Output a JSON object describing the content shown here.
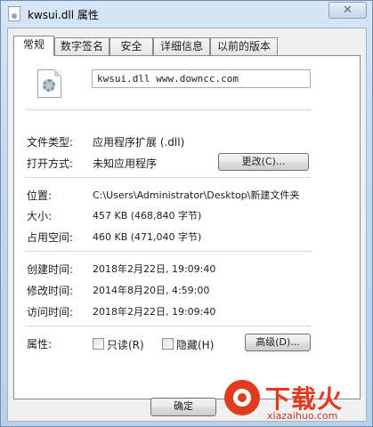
{
  "window": {
    "title": "kwsui.dll 属性",
    "close_glyph": "✕"
  },
  "tabs": [
    {
      "label": "常规",
      "active": true
    },
    {
      "label": "数字签名",
      "active": false
    },
    {
      "label": "安全",
      "active": false
    },
    {
      "label": "详细信息",
      "active": false
    },
    {
      "label": "以前的版本",
      "active": false
    }
  ],
  "general": {
    "file_name": "kwsui.dll www.downcc.com",
    "file_type_label": "文件类型:",
    "file_type_value": "应用程序扩展 (.dll)",
    "opens_with_label": "打开方式:",
    "opens_with_value": "未知应用程序",
    "change_button": "更改(C)...",
    "location_label": "位置:",
    "location_value": "C:\\Users\\Administrator\\Desktop\\新建文件夹",
    "size_label": "大小:",
    "size_value": "457 KB (468,840 字节)",
    "size_on_disk_label": "占用空间:",
    "size_on_disk_value": "460 KB (471,040 字节)",
    "created_label": "创建时间:",
    "created_value": "2018年2月22日, 19:09:40",
    "modified_label": "修改时间:",
    "modified_value": "2014年8月20日, 4:59:00",
    "accessed_label": "访问时间:",
    "accessed_value": "2018年2月22日, 19:09:40",
    "attributes_label": "属性:",
    "readonly_label": "只读(R)",
    "readonly_checked": false,
    "hidden_label": "隐藏(H)",
    "hidden_checked": false,
    "advanced_button": "高级(D)..."
  },
  "footer": {
    "ok_button": "确定"
  },
  "watermark": {
    "brand": "下载火",
    "url": "xiazaihuo.com",
    "color": "#e03a1f"
  }
}
